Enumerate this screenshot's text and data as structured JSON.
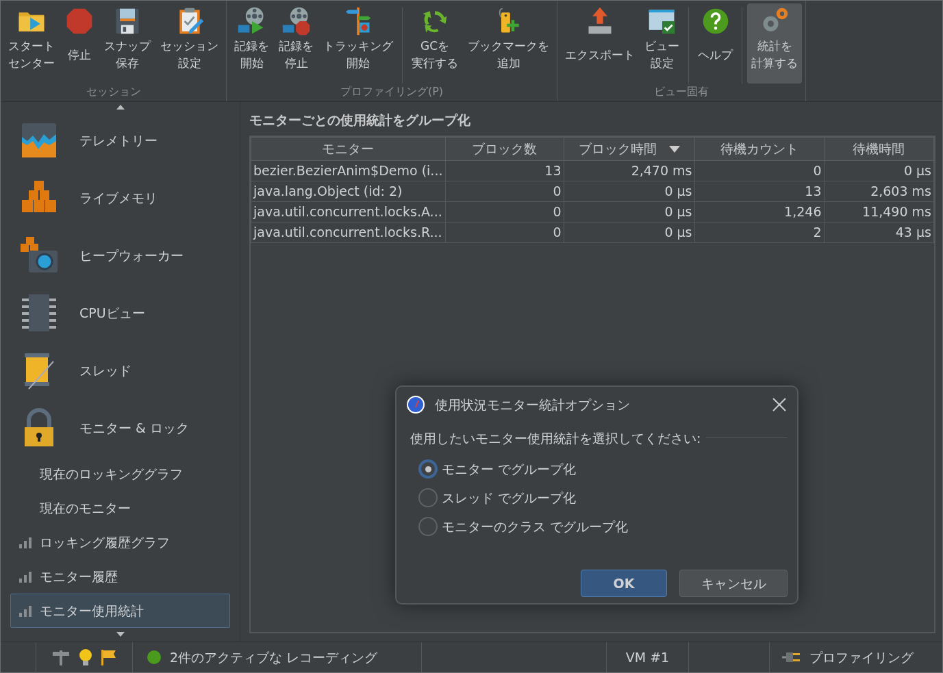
{
  "toolbar": {
    "groups": [
      {
        "label": "セッション",
        "buttons": [
          {
            "lines": [
              "スタート",
              "センター"
            ],
            "selected": false,
            "separator_before": false
          },
          {
            "lines": [
              "停止"
            ],
            "selected": false,
            "separator_before": false
          },
          {
            "lines": [
              "スナップ",
              "保存"
            ],
            "selected": false,
            "separator_before": false
          },
          {
            "lines": [
              "セッション",
              "設定"
            ],
            "selected": false,
            "separator_before": false
          }
        ]
      },
      {
        "label": "プロファイリング(P)",
        "buttons": [
          {
            "lines": [
              "記録を",
              "開始"
            ],
            "selected": false,
            "separator_before": false
          },
          {
            "lines": [
              "記録を",
              "停止"
            ],
            "selected": false,
            "separator_before": false
          },
          {
            "lines": [
              "トラッキング",
              "開始"
            ],
            "selected": false,
            "separator_before": false
          },
          {
            "lines": [
              "GCを",
              "実行する"
            ],
            "selected": false,
            "separator_before": true
          },
          {
            "lines": [
              "ブックマークを",
              "追加"
            ],
            "selected": false,
            "separator_before": false
          }
        ]
      },
      {
        "label": "ビュー固有",
        "buttons": [
          {
            "lines": [
              "エクスポート"
            ],
            "selected": false,
            "separator_before": false
          },
          {
            "lines": [
              "ビュー",
              "設定"
            ],
            "selected": false,
            "separator_before": false
          },
          {
            "lines": [
              "ヘルプ"
            ],
            "selected": false,
            "separator_before": true
          },
          {
            "lines": [
              "統計を",
              "計算する"
            ],
            "selected": true,
            "separator_before": true
          }
        ]
      }
    ]
  },
  "sidebar": {
    "items": [
      {
        "label": "テレメトリー",
        "kind": "large",
        "selected": false
      },
      {
        "label": "ライブメモリ",
        "kind": "large",
        "selected": false
      },
      {
        "label": "ヒープウォーカー",
        "kind": "large",
        "selected": false
      },
      {
        "label": "CPUビュー",
        "kind": "large",
        "selected": false
      },
      {
        "label": "スレッド",
        "kind": "large",
        "selected": false
      },
      {
        "label": "モニター & ロック",
        "kind": "large",
        "selected": false
      },
      {
        "label": "現在のロッキンググラフ",
        "kind": "sub",
        "selected": false
      },
      {
        "label": "現在のモニター",
        "kind": "sub",
        "selected": false
      },
      {
        "label": "ロッキング履歴グラフ",
        "kind": "chart",
        "selected": false
      },
      {
        "label": "モニター履歴",
        "kind": "chart",
        "selected": false
      },
      {
        "label": "モニター使用統計",
        "kind": "chart",
        "selected": true
      }
    ]
  },
  "main": {
    "title": "モニターごとの使用統計をグループ化",
    "table": {
      "columns": [
        {
          "label": "モニター",
          "sorted": false
        },
        {
          "label": "ブロック数",
          "sorted": false
        },
        {
          "label": "ブロック時間",
          "sorted": true
        },
        {
          "label": "待機カウント",
          "sorted": false
        },
        {
          "label": "待機時間",
          "sorted": false
        }
      ],
      "rows": [
        [
          "bezier.BezierAnim$Demo (i...",
          "13",
          "2,470 ms",
          "0",
          "0 µs"
        ],
        [
          "java.lang.Object (id: 2)",
          "0",
          "0 µs",
          "13",
          "2,603 ms"
        ],
        [
          "java.util.concurrent.locks.A...",
          "0",
          "0 µs",
          "1,246",
          "11,490 ms"
        ],
        [
          "java.util.concurrent.locks.R...",
          "0",
          "0 µs",
          "2",
          "43 µs"
        ]
      ]
    }
  },
  "dialog": {
    "title": "使用状況モニター統計オプション",
    "prompt": "使用したいモニター使用統計を選択してください:",
    "options": [
      {
        "label": "モニター でグループ化",
        "selected": true
      },
      {
        "label": "スレッド でグループ化",
        "selected": false
      },
      {
        "label": "モニターのクラス でグループ化",
        "selected": false
      }
    ],
    "buttons": [
      {
        "label": "OK",
        "kind": "primary"
      },
      {
        "label": "キャンセル",
        "kind": "secondary"
      }
    ]
  },
  "status_bar": {
    "recording": "2件のアクティブな レコーディング",
    "vm": "VM #1",
    "mode": "プロファイリング"
  }
}
